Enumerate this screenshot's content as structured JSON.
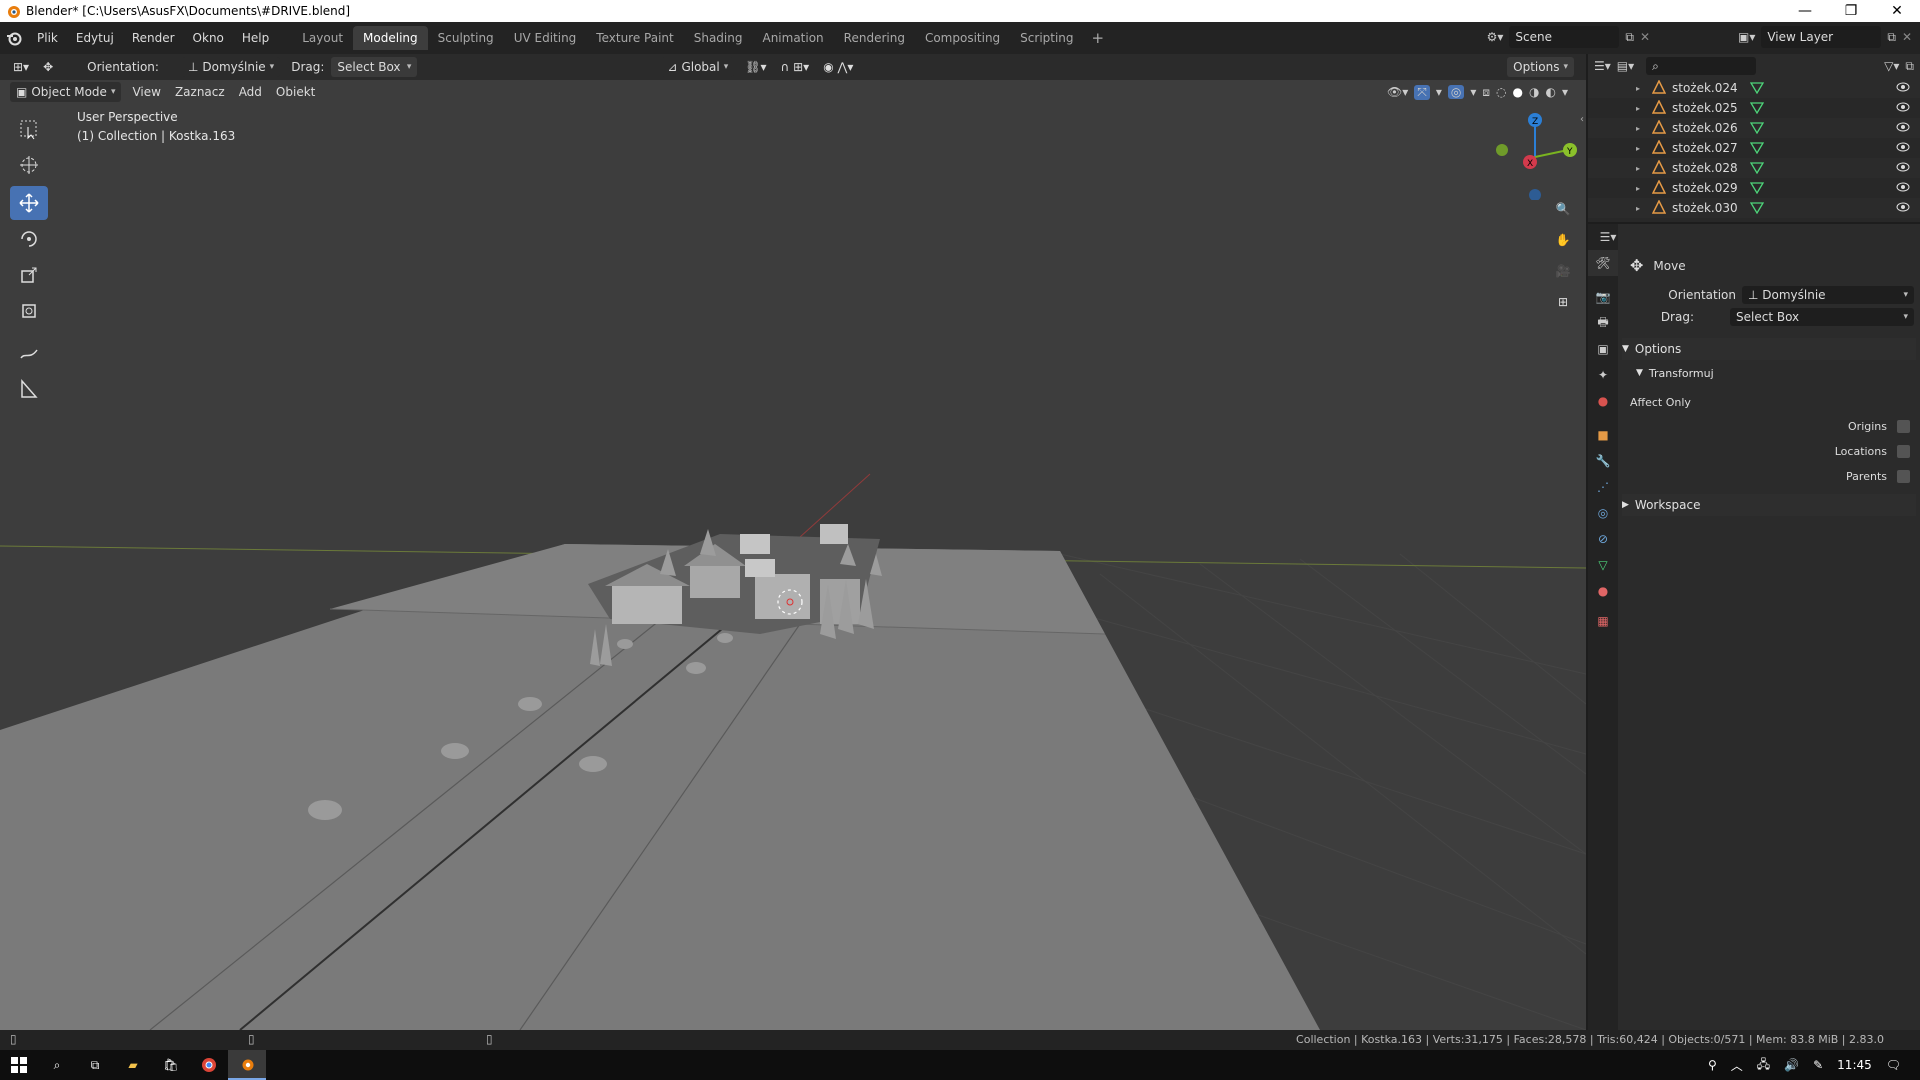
{
  "window": {
    "title": "Blender* [C:\\Users\\AsusFX\\Documents\\#DRIVE.blend]"
  },
  "menu": [
    "Plik",
    "Edytuj",
    "Render",
    "Okno",
    "Help"
  ],
  "workspaces": [
    {
      "label": "Layout",
      "active": false
    },
    {
      "label": "Modeling",
      "active": true
    },
    {
      "label": "Sculpting",
      "active": false
    },
    {
      "label": "UV Editing",
      "active": false
    },
    {
      "label": "Texture Paint",
      "active": false
    },
    {
      "label": "Shading",
      "active": false
    },
    {
      "label": "Animation",
      "active": false
    },
    {
      "label": "Rendering",
      "active": false
    },
    {
      "label": "Compositing",
      "active": false
    },
    {
      "label": "Scripting",
      "active": false
    }
  ],
  "scene": {
    "name": "Scene",
    "view_layer": "View Layer"
  },
  "tool_header": {
    "orientation_label": "Orientation:",
    "orientation_value": "Domyślnie",
    "drag_label": "Drag:",
    "drag_value": "Select Box",
    "transform_space": "Global",
    "options": "Options"
  },
  "viewport_header": {
    "mode": "Object Mode",
    "menus": [
      "View",
      "Zaznacz",
      "Add",
      "Obiekt"
    ]
  },
  "viewport_overlay": {
    "view_name": "User Perspective",
    "collection_info": "(1) Collection | Kostka.163"
  },
  "gizmo": {
    "z": "Z",
    "y": "Y",
    "x": "X"
  },
  "outliner": {
    "items": [
      "stożek.024",
      "stożek.025",
      "stożek.026",
      "stożek.027",
      "stożek.028",
      "stożek.029",
      "stożek.030"
    ]
  },
  "properties": {
    "tool_name": "Move",
    "orientation_label": "Orientation",
    "orientation_value": "Domyślnie",
    "drag_label": "Drag:",
    "drag_value": "Select Box",
    "options_section": "Options",
    "transform_sub": "Transformuj",
    "affect_only": "Affect Only",
    "origins": "Origins",
    "locations": "Locations",
    "parents": "Parents",
    "workspace_section": "Workspace"
  },
  "status": {
    "stats": "Collection | Kostka.163 | Verts:31,175 | Faces:28,578 | Tris:60,424 | Objects:0/571 | Mem: 83.8 MiB | 2.83.0"
  },
  "taskbar": {
    "time": "11:45"
  },
  "colors": {
    "accent": "#4772b3",
    "viewport": "#3d3d3d",
    "panel": "#303030"
  }
}
